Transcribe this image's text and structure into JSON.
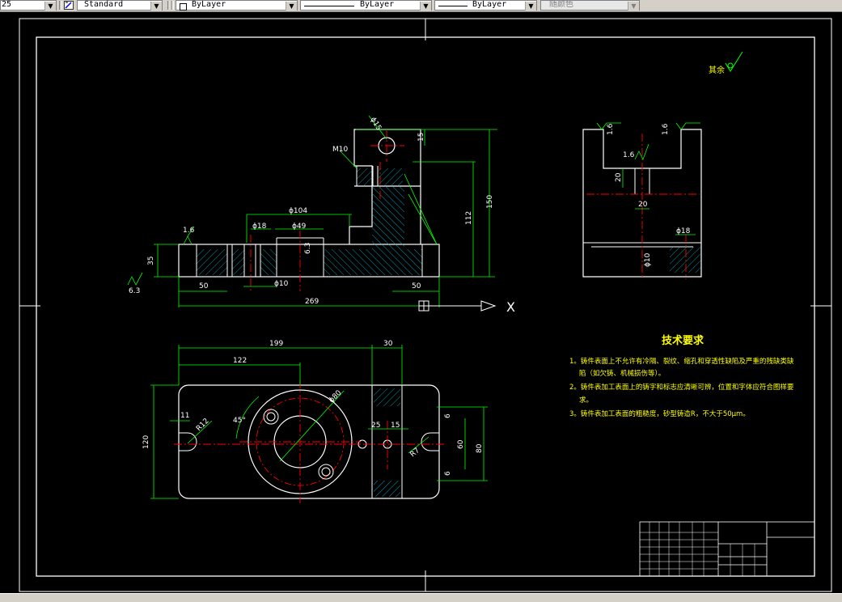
{
  "toolbar": {
    "scale_value": "25",
    "text_style": "Standard",
    "layer": "ByLayer",
    "linetype": "ByLayer",
    "lineweight": "ByLayer",
    "plot_style": "随颜色"
  },
  "drawing": {
    "roughness_other": "其余",
    "front_view": {
      "dim_phi15": "ϕ15",
      "dim_m10": "M10",
      "dim_15": "15",
      "dim_150": "150",
      "dim_112": "112",
      "dim_phi104": "ϕ104",
      "dim_phi18": "ϕ18",
      "dim_phi49": "ϕ49",
      "dim_35": "35",
      "dim_6_3_a": "6.3",
      "dim_6_3_b": "6.3",
      "dim_1_6": "1.6",
      "dim_50_left": "50",
      "dim_50_right": "50",
      "dim_phi10": "ϕ10",
      "dim_269": "269",
      "axis_x": "X"
    },
    "side_view": {
      "dim_1_6_a": "1.6",
      "dim_1_6_b": "1.6",
      "dim_1_6_c": "1.6",
      "dim_20_v": "20",
      "dim_20_h": "20",
      "dim_phi18": "ϕ18",
      "dim_phi10": "ϕ10"
    },
    "top_view": {
      "dim_199": "199",
      "dim_30": "30",
      "dim_122": "122",
      "dim_120": "120",
      "dim_11": "11",
      "dim_r12": "R12",
      "dim_45": "45°",
      "dim_phi80": "ϕ80",
      "dim_25": "25",
      "dim_15": "15",
      "dim_r7": "R7",
      "dim_60": "60",
      "dim_80": "80",
      "dim_6a": "6",
      "dim_6b": "6"
    },
    "tech_requirements": {
      "title": "技术要求",
      "lines": [
        "1。铸件表面上不允许有冷隔、裂纹、缩孔和穿透性缺陷及严重的残缺类缺",
        "陷（如欠铸、机械损伤等）。",
        "2。铸件表加工表面上的铸字和标志应清晰可辨，位置和字体应符合图样要",
        "求。",
        "3。铸件表加工表面的粗糙度，砂型铸造R，不大于50μm。"
      ]
    }
  }
}
